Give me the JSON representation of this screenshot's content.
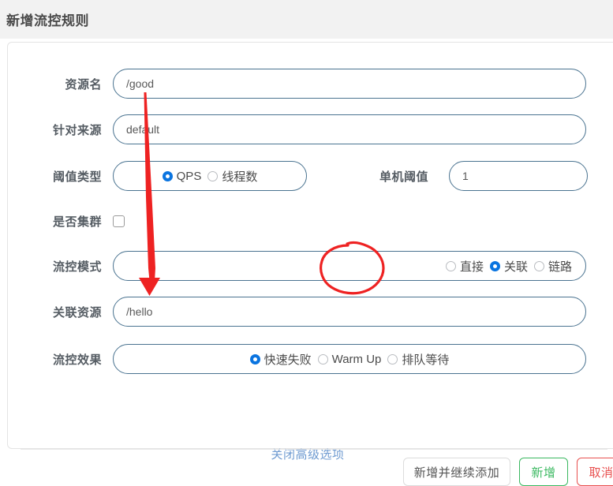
{
  "dialog": {
    "title": "新增流控规则"
  },
  "form": {
    "resource": {
      "label": "资源名",
      "value": "/good"
    },
    "limit_origin": {
      "label": "针对来源",
      "value": "default"
    },
    "threshold_type": {
      "label": "阈值类型",
      "options": [
        {
          "label": "QPS",
          "selected": true
        },
        {
          "label": "线程数",
          "selected": false
        }
      ]
    },
    "single_threshold": {
      "label": "单机阈值",
      "value": "1"
    },
    "cluster": {
      "label": "是否集群",
      "checked": false
    },
    "flow_mode": {
      "label": "流控模式",
      "options": [
        {
          "label": "直接",
          "selected": false
        },
        {
          "label": "关联",
          "selected": true
        },
        {
          "label": "链路",
          "selected": false
        }
      ]
    },
    "ref_resource": {
      "label": "关联资源",
      "value": "/hello"
    },
    "flow_effect": {
      "label": "流控效果",
      "options": [
        {
          "label": "快速失败",
          "selected": true
        },
        {
          "label": "Warm Up",
          "selected": false
        },
        {
          "label": "排队等待",
          "selected": false
        }
      ]
    },
    "advanced_toggle": "关闭高级选项"
  },
  "footer": {
    "add_continue_label": "新增并继续添加",
    "add_label": "新增",
    "cancel_label": "取消"
  },
  "annotations": {
    "color": "#ee2222",
    "arrow_name": "red-arrow-annotation",
    "circle_name": "red-circle-annotation"
  },
  "colors": {
    "header_bg": "#f2f2f2",
    "input_border": "#4a7390",
    "radio_selected": "#0a74e0",
    "link": "#6f9bd1",
    "success": "#3ab860",
    "danger": "#e8504f",
    "annotation_red": "#ee2222"
  }
}
